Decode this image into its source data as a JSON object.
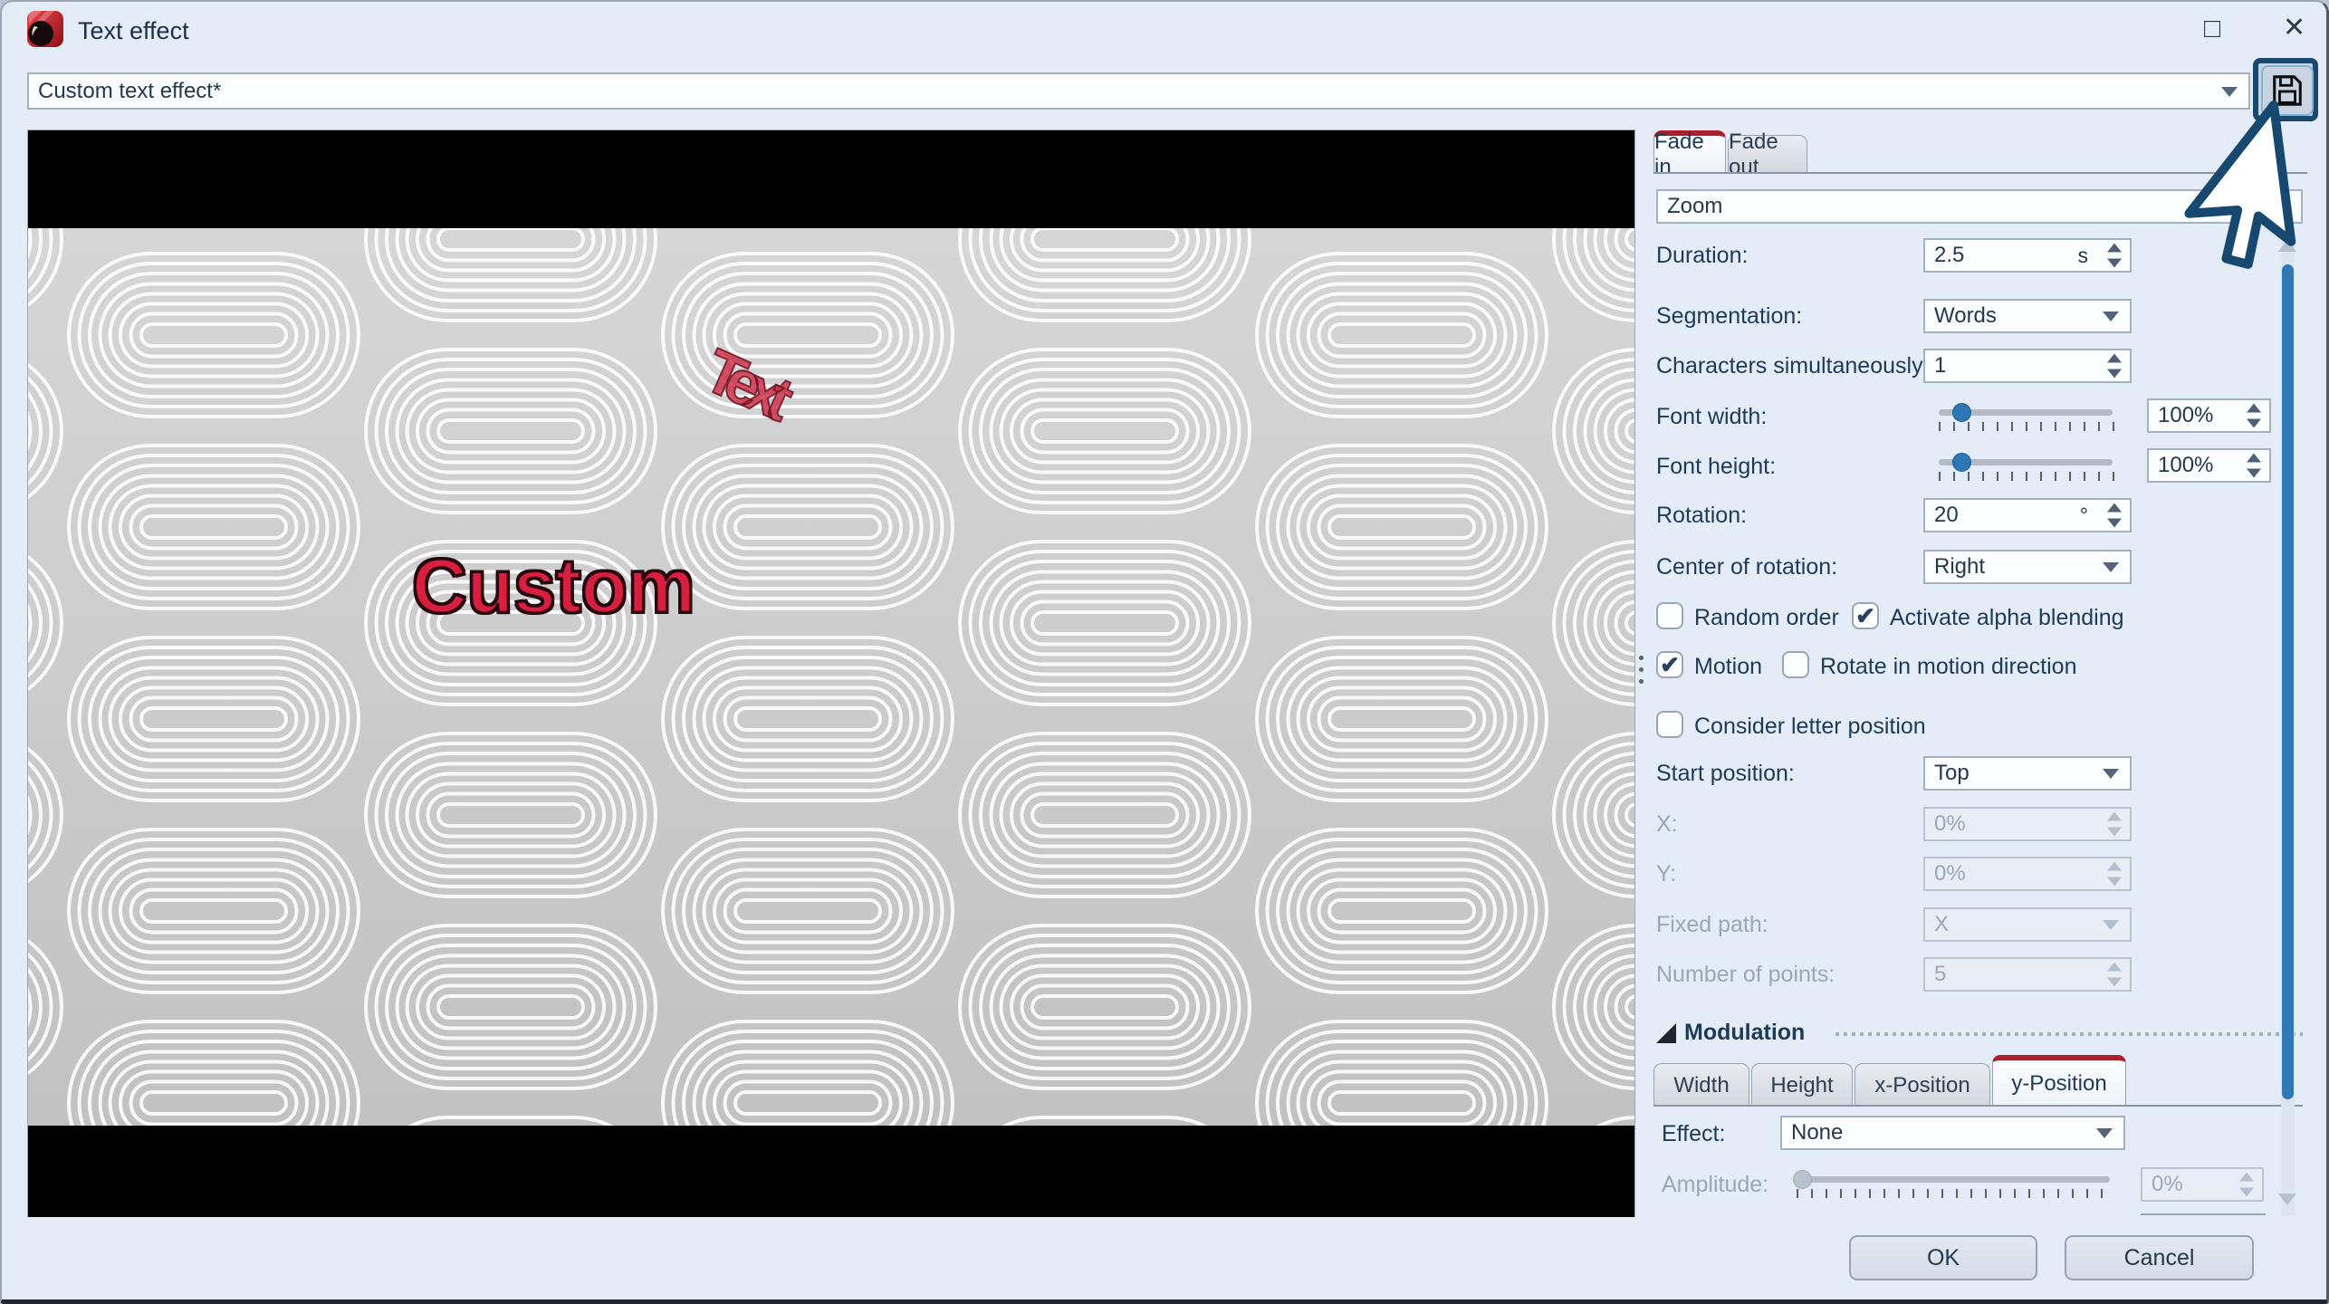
{
  "window": {
    "title": "Text effect",
    "maximize_glyph": "□",
    "close_glyph": "✕"
  },
  "preset": {
    "value": "Custom text effect*"
  },
  "preview": {
    "text_main": "Custom",
    "text_overlay": "Text"
  },
  "panel": {
    "tabs": [
      {
        "label": "Fade in",
        "active": true
      },
      {
        "label": "Fade out",
        "active": false
      }
    ],
    "effect_preset": "Zoom",
    "duration": {
      "label": "Duration:",
      "value": "2.5",
      "unit": "s"
    },
    "segmentation": {
      "label": "Segmentation:",
      "value": "Words"
    },
    "characters": {
      "label": "Characters simultaneously:",
      "value": "1"
    },
    "font_width": {
      "label": "Font width:",
      "value": "100%"
    },
    "font_height": {
      "label": "Font height:",
      "value": "100%"
    },
    "rotation": {
      "label": "Rotation:",
      "value": "20",
      "unit": "°"
    },
    "center_of_rotation": {
      "label": "Center of rotation:",
      "value": "Right"
    },
    "checkboxes": {
      "random_order": {
        "label": "Random order",
        "checked": false
      },
      "alpha_blending": {
        "label": "Activate alpha blending",
        "checked": true
      },
      "motion": {
        "label": "Motion",
        "checked": true
      },
      "rotate_motion": {
        "label": "Rotate in motion direction",
        "checked": false
      },
      "letter_position": {
        "label": "Consider letter position",
        "checked": false
      }
    },
    "start_position": {
      "label": "Start position:",
      "value": "Top"
    },
    "x": {
      "label": "X:",
      "value": "0%"
    },
    "y": {
      "label": "Y:",
      "value": "0%"
    },
    "fixed_path": {
      "label": "Fixed path:",
      "value": "X"
    },
    "number_points": {
      "label": "Number of points:",
      "value": "5"
    },
    "modulation": {
      "header": "Modulation",
      "tabs": [
        "Width",
        "Height",
        "x-Position",
        "y-Position"
      ],
      "active_tab": "y-Position",
      "effect": {
        "label": "Effect:",
        "value": "None"
      },
      "amplitude": {
        "label": "Amplitude:",
        "value": "0%"
      }
    }
  },
  "footer": {
    "ok": "OK",
    "cancel": "Cancel"
  },
  "icons": {
    "check_glyph": "✔"
  },
  "colors": {
    "accent_red": "#ac1f2d",
    "accent_blue": "#2e77b6",
    "highlight_navy": "#17486f",
    "text_red": "#d81f3f"
  }
}
